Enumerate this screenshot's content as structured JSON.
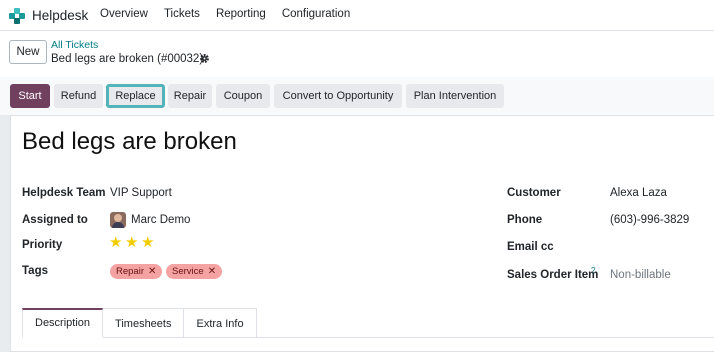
{
  "navbar": {
    "app_name": "Helpdesk",
    "menu": [
      "Overview",
      "Tickets",
      "Reporting",
      "Configuration"
    ]
  },
  "control": {
    "new_label": "New",
    "breadcrumb_parent": "All Tickets",
    "breadcrumb_current": "Bed legs are broken (#00032)"
  },
  "actions": [
    "Start",
    "Refund",
    "Replace",
    "Repair",
    "Coupon",
    "Convert to Opportunity",
    "Plan Intervention"
  ],
  "form": {
    "title": "Bed legs are broken",
    "left": {
      "team_label": "Helpdesk Team",
      "team_value": "VIP Support",
      "assigned_label": "Assigned to",
      "assigned_value": "Marc Demo",
      "priority_label": "Priority",
      "priority_stars": 3,
      "tags_label": "Tags",
      "tags": [
        "Repair",
        "Service"
      ]
    },
    "right": {
      "customer_label": "Customer",
      "customer_value": "Alexa Laza",
      "phone_label": "Phone",
      "phone_value": "(603)-996-3829",
      "email_label": "Email cc",
      "sale_label": "Sales Order Item",
      "sale_help": "?",
      "sale_value": "Non-billable"
    }
  },
  "tabs": [
    "Description",
    "Timesheets",
    "Extra Info"
  ],
  "colors": {
    "primary": "#71405f",
    "link": "#017e84",
    "highlight": "#52b4b8",
    "star": "#f3cc00",
    "tag": "#f4a2a2"
  }
}
